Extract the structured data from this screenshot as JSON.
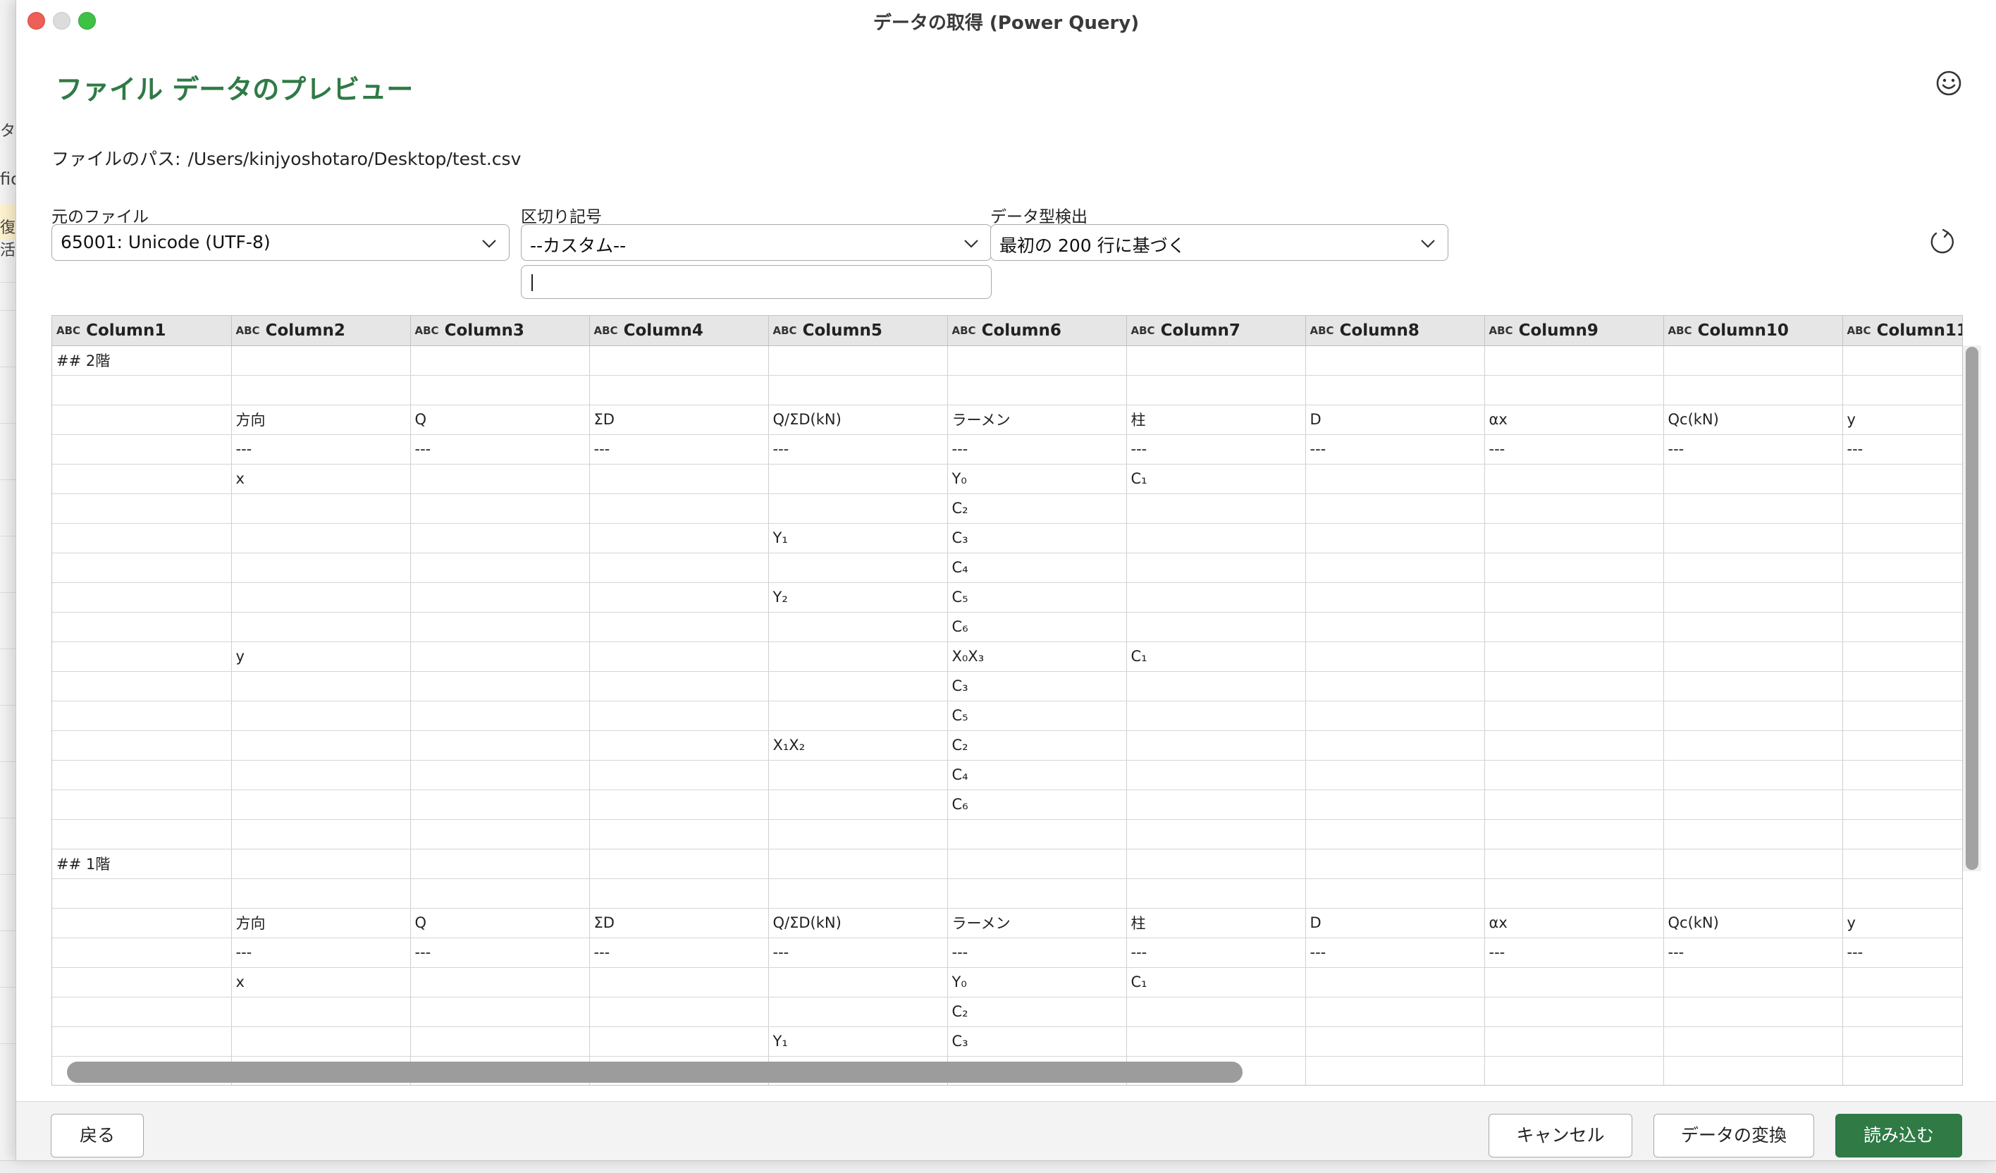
{
  "background_app": {
    "fragments": [
      "タ",
      "fic",
      "復活"
    ]
  },
  "window": {
    "title": "データの取得 (Power Query)"
  },
  "dialog": {
    "heading": "ファイル データのプレビュー",
    "feedback_icon": "smiley-icon",
    "file_path_label": "ファイルのパス:",
    "file_path_value": "/Users/kinjyoshotaro/Desktop/test.csv",
    "origin": {
      "label": "元のファイル",
      "value": "65001: Unicode (UTF-8)"
    },
    "delimiter": {
      "label": "区切り記号",
      "value": "--カスタム--",
      "custom_value": ""
    },
    "type_detection": {
      "label": "データ型検出",
      "value": "最初の 200 行に基づく"
    },
    "refresh_icon": "refresh-icon"
  },
  "grid": {
    "type_badge": "ABC",
    "columns": [
      "Column1",
      "Column2",
      "Column3",
      "Column4",
      "Column5",
      "Column6",
      "Column7",
      "Column8",
      "Column9",
      "Column10",
      "Column11"
    ],
    "rows": [
      [
        "## 2階",
        "",
        "",
        "",
        "",
        "",
        "",
        "",
        "",
        "",
        ""
      ],
      [
        "",
        "",
        "",
        "",
        "",
        "",
        "",
        "",
        "",
        "",
        ""
      ],
      [
        "",
        "方向",
        "Q",
        "ΣD",
        "Q/ΣD(kN)",
        "ラーメン",
        "柱",
        "D",
        "αx",
        "Qc(kN)",
        "y"
      ],
      [
        "",
        "---",
        "---",
        "---",
        "---",
        "---",
        "---",
        "---",
        "---",
        "---",
        "---"
      ],
      [
        "",
        "x",
        "",
        "",
        "",
        "Y₀",
        "C₁",
        "",
        "",
        "",
        ""
      ],
      [
        "",
        "",
        "",
        "",
        "",
        "C₂",
        "",
        "",
        "",
        "",
        ""
      ],
      [
        "",
        "",
        "",
        "",
        "Y₁",
        "C₃",
        "",
        "",
        "",
        "",
        ""
      ],
      [
        "",
        "",
        "",
        "",
        "",
        "C₄",
        "",
        "",
        "",
        "",
        ""
      ],
      [
        "",
        "",
        "",
        "",
        "Y₂",
        "C₅",
        "",
        "",
        "",
        "",
        ""
      ],
      [
        "",
        "",
        "",
        "",
        "",
        "C₆",
        "",
        "",
        "",
        "",
        ""
      ],
      [
        "",
        "y",
        "",
        "",
        "",
        "X₀X₃",
        "C₁",
        "",
        "",
        "",
        ""
      ],
      [
        "",
        "",
        "",
        "",
        "",
        "C₃",
        "",
        "",
        "",
        "",
        ""
      ],
      [
        "",
        "",
        "",
        "",
        "",
        "C₅",
        "",
        "",
        "",
        "",
        ""
      ],
      [
        "",
        "",
        "",
        "",
        "X₁X₂",
        "C₂",
        "",
        "",
        "",
        "",
        ""
      ],
      [
        "",
        "",
        "",
        "",
        "",
        "C₄",
        "",
        "",
        "",
        "",
        ""
      ],
      [
        "",
        "",
        "",
        "",
        "",
        "C₆",
        "",
        "",
        "",
        "",
        ""
      ],
      [
        "",
        "",
        "",
        "",
        "",
        "",
        "",
        "",
        "",
        "",
        ""
      ],
      [
        "## 1階",
        "",
        "",
        "",
        "",
        "",
        "",
        "",
        "",
        "",
        ""
      ],
      [
        "",
        "",
        "",
        "",
        "",
        "",
        "",
        "",
        "",
        "",
        ""
      ],
      [
        "",
        "方向",
        "Q",
        "ΣD",
        "Q/ΣD(kN)",
        "ラーメン",
        "柱",
        "D",
        "αx",
        "Qc(kN)",
        "y"
      ],
      [
        "",
        "---",
        "---",
        "---",
        "---",
        "---",
        "---",
        "---",
        "---",
        "---",
        "---"
      ],
      [
        "",
        "x",
        "",
        "",
        "",
        "Y₀",
        "C₁",
        "",
        "",
        "",
        ""
      ],
      [
        "",
        "",
        "",
        "",
        "",
        "C₂",
        "",
        "",
        "",
        "",
        ""
      ],
      [
        "",
        "",
        "",
        "",
        "Y₁",
        "C₃",
        "",
        "",
        "",
        "",
        ""
      ],
      [
        "",
        "",
        "",
        "",
        "",
        "",
        "",
        "",
        "",
        "",
        ""
      ]
    ]
  },
  "footer": {
    "back_label": "戻る",
    "cancel_label": "キャンセル",
    "transform_label": "データの変換",
    "load_label": "読み込む"
  }
}
